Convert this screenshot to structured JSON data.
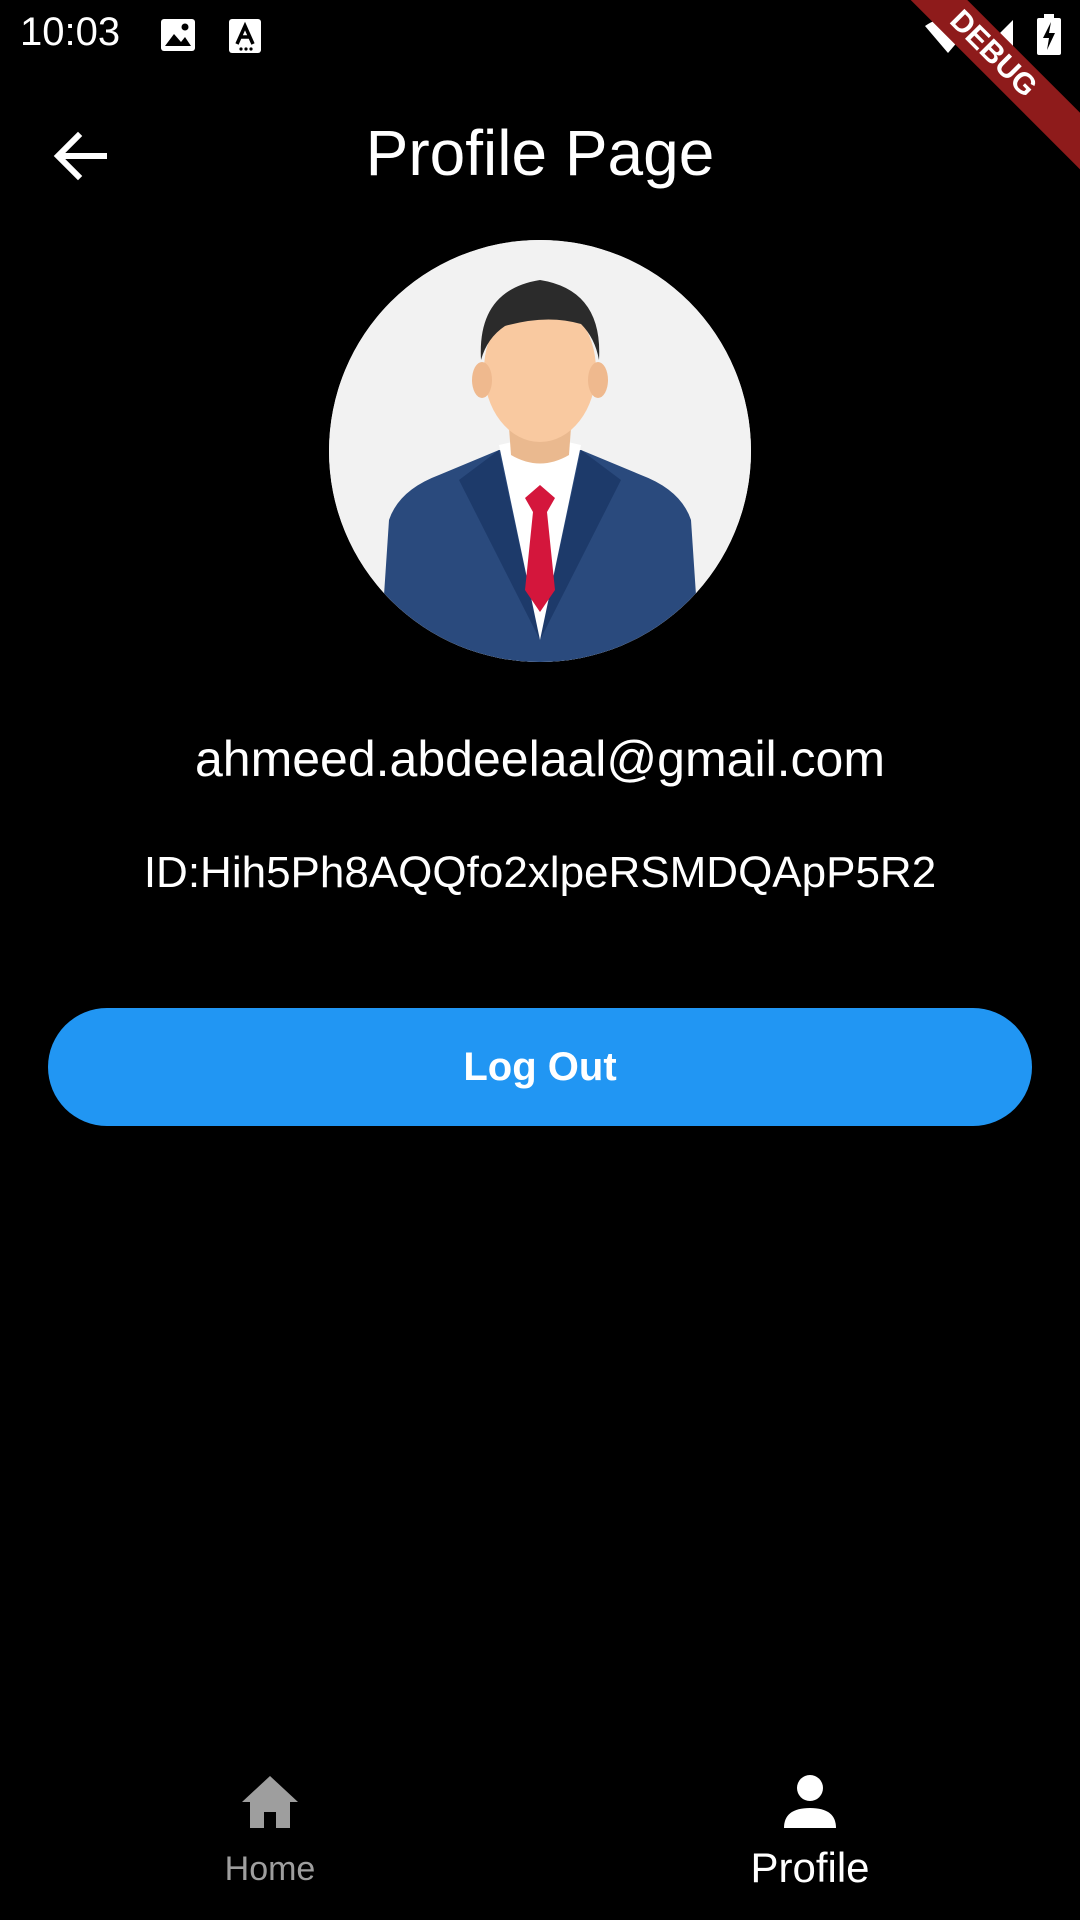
{
  "status_bar": {
    "time": "10:03",
    "icons": [
      "image-icon",
      "text-a-icon",
      "wifi-icon",
      "signal-icon",
      "battery-charging-icon"
    ]
  },
  "debug_banner": "DEBUG",
  "app_bar": {
    "title": "Profile Page",
    "back_icon": "arrow-back-icon"
  },
  "profile": {
    "avatar": "businessman-avatar",
    "email": "ahmeed.abdeelaal@gmail.com",
    "id_text": "ID:Hih5Ph8AQQfo2xlpeRSMDQApP5R2"
  },
  "logout_button": {
    "label": "Log Out",
    "color": "#2196f3"
  },
  "bottom_nav": {
    "items": [
      {
        "label": "Home",
        "icon": "home-icon",
        "active": false
      },
      {
        "label": "Profile",
        "icon": "person-icon",
        "active": true
      }
    ],
    "active_color": "#ffffff",
    "inactive_color": "#9e9e9e"
  }
}
